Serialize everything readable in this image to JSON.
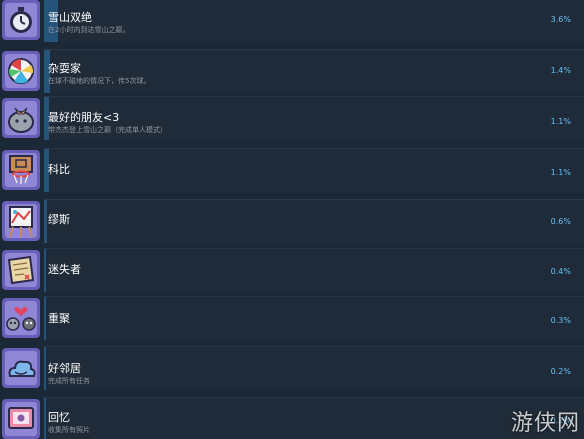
{
  "achievements": [
    {
      "title": "雪山双绝",
      "description": "在2小时内到达雪山之巅。",
      "percent": "3.6%",
      "percent_value": 3.6,
      "icon": "stopwatch-icon"
    },
    {
      "title": "杂耍家",
      "description": "在球不碰地的情况下，传5次球。",
      "percent": "1.4%",
      "percent_value": 1.4,
      "icon": "beach-ball-icon"
    },
    {
      "title": "最好的朋友<3",
      "description": "带杰杰登上雪山之巅（完成单人模式）",
      "percent": "1.1%",
      "percent_value": 1.1,
      "icon": "gift-rock-icon"
    },
    {
      "title": "科比",
      "description": "",
      "percent": "1.1%",
      "percent_value": 1.1,
      "icon": "basketball-hoop-icon"
    },
    {
      "title": "缪斯",
      "description": "",
      "percent": "0.6%",
      "percent_value": 0.6,
      "icon": "easel-icon"
    },
    {
      "title": "迷失者",
      "description": "",
      "percent": "0.4%",
      "percent_value": 0.4,
      "icon": "map-icon"
    },
    {
      "title": "重聚",
      "description": "",
      "percent": "0.3%",
      "percent_value": 0.3,
      "icon": "reunion-icon"
    },
    {
      "title": "好邻居",
      "description": "完成所有任务",
      "percent": "0.2%",
      "percent_value": 0.2,
      "icon": "cloud-icon"
    },
    {
      "title": "回忆",
      "description": "收集所有照片",
      "percent": "0.2%",
      "percent_value": 0.2,
      "icon": "photo-icon"
    }
  ],
  "watermark": "游侠网"
}
